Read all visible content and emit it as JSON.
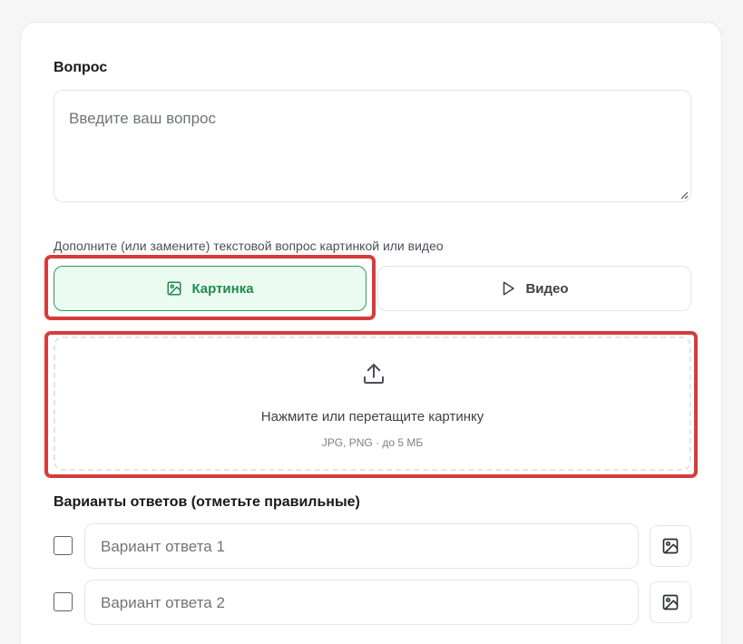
{
  "question": {
    "label": "Вопрос",
    "placeholder": "Введите ваш вопрос"
  },
  "media": {
    "hint": "Дополните (или замените) текстовой вопрос картинкой или видео",
    "image_label": "Картинка",
    "video_label": "Видео",
    "selected": "image"
  },
  "dropzone": {
    "title": "Нажмите или перетащите картинку",
    "subtitle": "JPG, PNG · до 5 МБ"
  },
  "answers": {
    "label": "Варианты ответов (отметьте правильные)",
    "items": [
      {
        "placeholder": "Вариант ответа 1",
        "checked": false
      },
      {
        "placeholder": "Вариант ответа 2",
        "checked": false
      }
    ]
  },
  "colors": {
    "accent_green": "#1f8a4c",
    "selected_bg": "#ebfbf2",
    "highlight_red": "#d63c3c"
  },
  "icons": {
    "image": "image-icon",
    "video": "play-icon",
    "upload": "upload-icon"
  }
}
